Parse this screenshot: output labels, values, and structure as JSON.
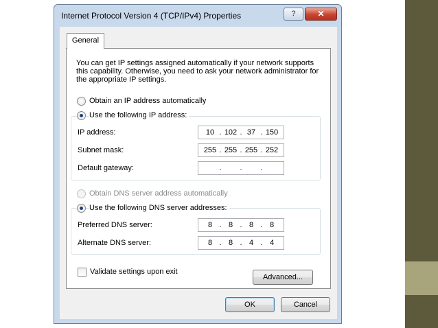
{
  "window": {
    "title": "Internet Protocol Version 4 (TCP/IPv4) Properties",
    "help_label": "?",
    "close_label": "✕"
  },
  "tabs": [
    {
      "label": "General",
      "selected": true
    }
  ],
  "general": {
    "description": "You can get IP settings assigned automatically if your network supports this capability. Otherwise, you need to ask your network administrator for the appropriate IP settings.",
    "ip_auto_label": "Obtain an IP address automatically",
    "ip_manual_label": "Use the following IP address:",
    "ip_mode": "manual",
    "ip_address": {
      "label": "IP address:",
      "octets": [
        "10",
        "102",
        "37",
        "150"
      ]
    },
    "subnet_mask": {
      "label": "Subnet mask:",
      "octets": [
        "255",
        "255",
        "255",
        "252"
      ]
    },
    "default_gateway": {
      "label": "Default gateway:",
      "octets": [
        "",
        "",
        "",
        ""
      ]
    },
    "dns_auto_label": "Obtain DNS server address automatically",
    "dns_manual_label": "Use the following DNS server addresses:",
    "dns_mode": "manual",
    "preferred_dns": {
      "label": "Preferred DNS server:",
      "octets": [
        "8",
        "8",
        "8",
        "8"
      ]
    },
    "alternate_dns": {
      "label": "Alternate DNS server:",
      "octets": [
        "8",
        "8",
        "4",
        "4"
      ]
    },
    "validate_label": "Validate settings upon exit",
    "validate_checked": false,
    "advanced_label": "Advanced..."
  },
  "footer": {
    "ok_label": "OK",
    "cancel_label": "Cancel"
  },
  "colors": {
    "titlebar": "#c9d9ec",
    "close_button": "#c8442f",
    "side_bar": "#5d5a3c",
    "side_bar_light": "#a8a47c"
  }
}
